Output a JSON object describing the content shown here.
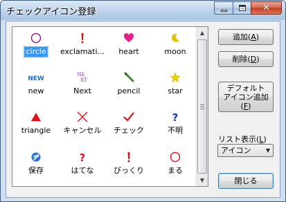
{
  "window": {
    "title": "チェックアイコン登録"
  },
  "caption": {
    "minimize": "minimize",
    "maximize": "maximize",
    "close": "✕"
  },
  "icons": [
    {
      "label": "circle",
      "icon": "circle-outline-icon",
      "color": "#8e1b8e",
      "selected": true
    },
    {
      "label": "exclamati...",
      "icon": "exclamation-icon",
      "color": "#e0101a"
    },
    {
      "label": "heart",
      "icon": "heart-icon",
      "color": "#e8208a"
    },
    {
      "label": "moon",
      "icon": "moon-icon",
      "color": "#e8c000"
    },
    {
      "label": "new",
      "icon": "new-text-icon",
      "color": "#1e6fd0",
      "text": "NEW"
    },
    {
      "label": "Next",
      "icon": "next-text-icon",
      "color": "#7a2fb8",
      "text": "NE XT"
    },
    {
      "label": "pencil",
      "icon": "pencil-icon",
      "color": "#3a8a2a"
    },
    {
      "label": "star",
      "icon": "star-icon",
      "color": "#e8d000"
    },
    {
      "label": "triangle",
      "icon": "triangle-icon",
      "color": "#e0101a"
    },
    {
      "label": "キャンセル",
      "icon": "cross-icon",
      "color": "#e0101a"
    },
    {
      "label": "チェック",
      "icon": "checkmark-icon",
      "color": "#e0101a"
    },
    {
      "label": "不明",
      "icon": "question-icon",
      "color": "#1040c0"
    },
    {
      "label": "保存",
      "icon": "save-globe-icon",
      "color": "#2a6fd0"
    },
    {
      "label": "はてな",
      "icon": "question-icon",
      "color": "#e0101a"
    },
    {
      "label": "びっくり",
      "icon": "exclamation-icon",
      "color": "#e0101a"
    },
    {
      "label": "まる",
      "icon": "circle-outline-icon",
      "color": "#e0101a"
    }
  ],
  "buttons": {
    "add": {
      "label": "追加(",
      "key": "A",
      "suffix": ")"
    },
    "delete": {
      "label": "削除(",
      "key": "D",
      "suffix": ")"
    },
    "default_add": {
      "line1": "デフォルト",
      "line2": "アイコン追加",
      "line3_pre": "(",
      "key": "F",
      "line3_suf": ")"
    },
    "close": {
      "label": "閉じる"
    }
  },
  "list_display": {
    "label_pre": "リスト表示(",
    "key": "L",
    "label_suf": ")",
    "value": "アイコン"
  }
}
